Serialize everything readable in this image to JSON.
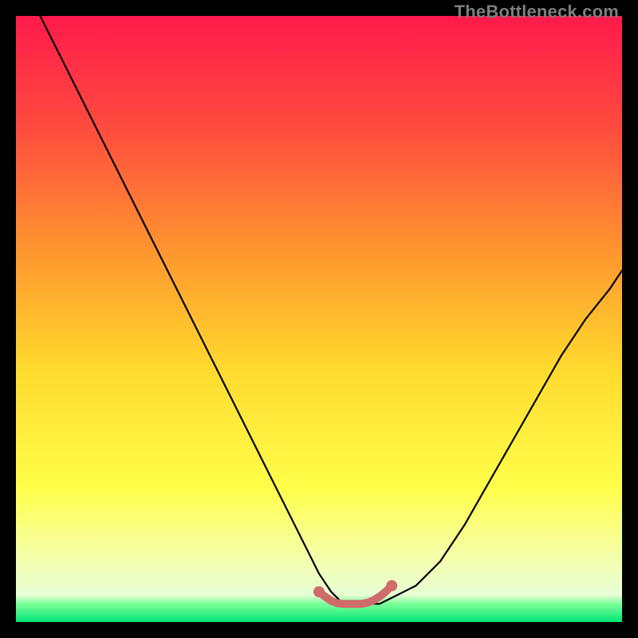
{
  "watermark": "TheBottleneck.com",
  "chart_data": {
    "type": "line",
    "title": "",
    "xlabel": "",
    "ylabel": "",
    "xlim": [
      0,
      100
    ],
    "ylim": [
      0,
      100
    ],
    "gradient_stops": [
      {
        "offset": 0,
        "color": "#ff1a4b"
      },
      {
        "offset": 0.18,
        "color": "#ff4a3f"
      },
      {
        "offset": 0.4,
        "color": "#ff9a2e"
      },
      {
        "offset": 0.58,
        "color": "#ffd92e"
      },
      {
        "offset": 0.78,
        "color": "#ffff4a"
      },
      {
        "offset": 0.9,
        "color": "#f4ffb0"
      },
      {
        "offset": 0.955,
        "color": "#e8ffd6"
      },
      {
        "offset": 0.97,
        "color": "#7dff9a"
      },
      {
        "offset": 1.0,
        "color": "#00e676"
      }
    ],
    "series": [
      {
        "name": "bottleneck-curve",
        "stroke": "#000000",
        "x": [
          4,
          8,
          12,
          16,
          20,
          24,
          28,
          32,
          36,
          40,
          44,
          48,
          50,
          52,
          54,
          56,
          58,
          60,
          62,
          66,
          70,
          74,
          78,
          82,
          86,
          90,
          94,
          98,
          100
        ],
        "values": [
          100,
          92,
          84,
          76,
          68,
          60,
          52,
          44,
          36,
          28,
          20,
          12,
          8,
          5,
          3,
          3,
          3,
          3,
          4,
          6,
          10,
          16,
          23,
          30,
          37,
          44,
          50,
          55,
          58
        ]
      },
      {
        "name": "optimal-highlight",
        "stroke": "#cf6b6b",
        "x": [
          50,
          51,
          52,
          53,
          54,
          55,
          56,
          57,
          58,
          59,
          60,
          61,
          62
        ],
        "values": [
          5,
          4.2,
          3.5,
          3.1,
          3.0,
          3.0,
          3.0,
          3.0,
          3.2,
          3.6,
          4.2,
          5.0,
          6.0
        ]
      }
    ],
    "highlight_markers": {
      "color": "#cf6b6b",
      "points": [
        {
          "x": 50,
          "y": 5
        },
        {
          "x": 62,
          "y": 6
        }
      ]
    }
  }
}
